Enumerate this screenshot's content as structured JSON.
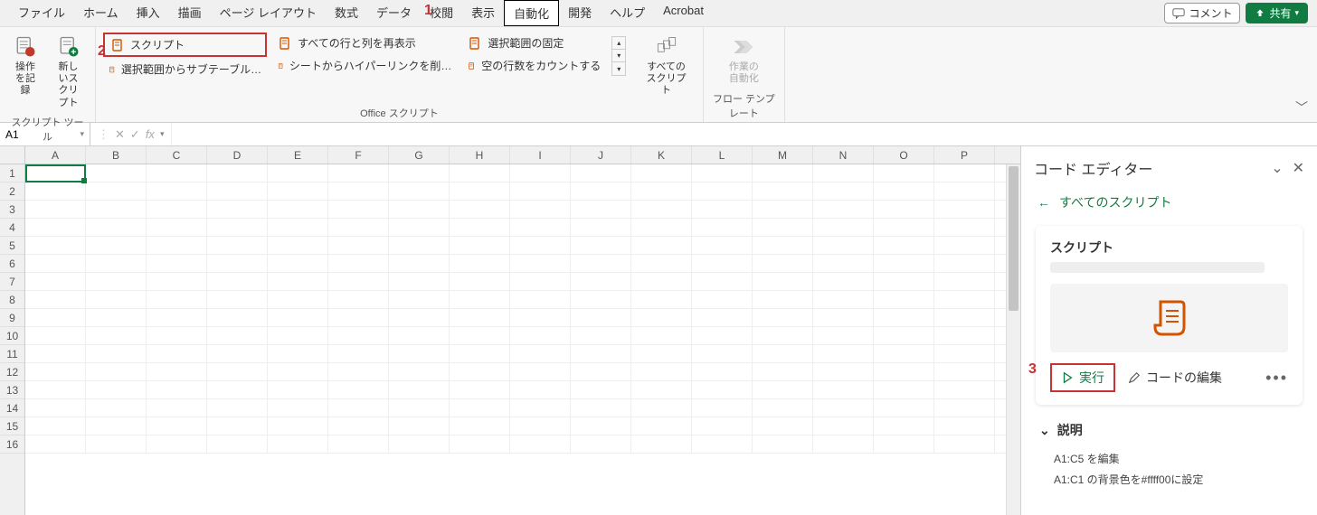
{
  "menu": {
    "items": [
      "ファイル",
      "ホーム",
      "挿入",
      "描画",
      "ページ レイアウト",
      "数式",
      "データ",
      "校閲",
      "表示",
      "自動化",
      "開発",
      "ヘルプ",
      "Acrobat"
    ],
    "active_index": 9,
    "comment_label": "コメント",
    "share_label": "共有"
  },
  "annotations": {
    "one": "1",
    "two": "2",
    "three": "3"
  },
  "ribbon": {
    "group1": {
      "record_label": "操作\nを記録",
      "new_script_label": "新しいス\nクリプト",
      "footer": "スクリプト ツール"
    },
    "group2": {
      "script_label": "スクリプト",
      "subtable_label": "選択範囲からサブテーブル…",
      "show_all_label": "すべての行と列を再表示",
      "hyperlink_label": "シートからハイパーリンクを削…",
      "freeze_label": "選択範囲の固定",
      "count_blank_label": "空の行数をカウントする",
      "all_scripts_label": "すべての\nスクリプト",
      "footer": "Office スクリプト"
    },
    "group3": {
      "automate_label": "作業の\n自動化",
      "footer": "フロー テンプレート"
    }
  },
  "formula_bar": {
    "name_box": "A1",
    "formula": ""
  },
  "grid": {
    "columns": [
      "A",
      "B",
      "C",
      "D",
      "E",
      "F",
      "G",
      "H",
      "I",
      "J",
      "K",
      "L",
      "M",
      "N",
      "O",
      "P"
    ],
    "rows": [
      1,
      2,
      3,
      4,
      5,
      6,
      7,
      8,
      9,
      10,
      11,
      12,
      13,
      14,
      15,
      16
    ]
  },
  "panel": {
    "title": "コード エディター",
    "back_label": "すべてのスクリプト",
    "card_title": "スクリプト",
    "run_label": "実行",
    "edit_label": "コードの編集",
    "desc_header": "説明",
    "desc_lines": [
      "A1:C5 を編集",
      "A1:C1 の背景色を#ffff00に設定"
    ]
  }
}
